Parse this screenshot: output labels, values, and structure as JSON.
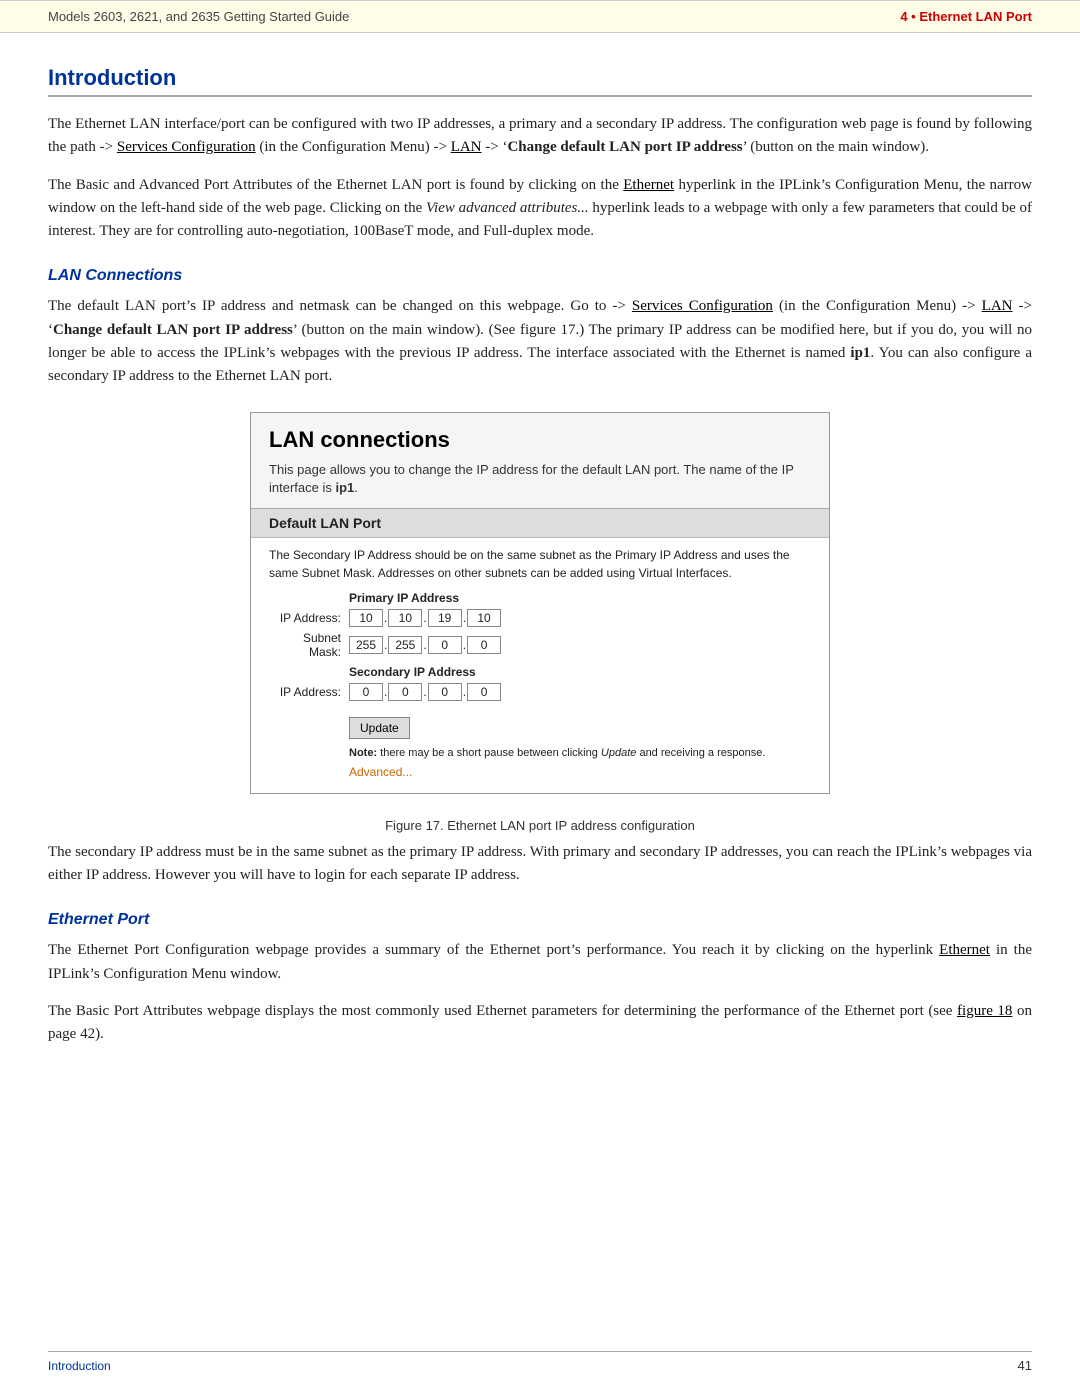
{
  "header": {
    "left": "Models 2603, 2621, and 2635 Getting Started Guide",
    "right_prefix": "4  •  ",
    "right_title": "Ethernet LAN Port"
  },
  "section": {
    "title": "Introduction",
    "paragraphs": [
      "The Ethernet LAN interface/port can be configured with two IP addresses, a primary and a secondary IP address. The configuration web page is found by following the path -> Services Configuration (in the Configuration Menu) -> LAN -> 'Change default LAN port IP address' (button on the main window).",
      "The Basic and Advanced Port Attributes of the Ethernet LAN port is found by clicking on the Ethernet hyperlink in the IPLink's Configuration Menu, the narrow window on the left-hand side of the web page. Clicking on the View advanced attributes... hyperlink leads to a webpage with only a few parameters that could be of interest. They are for controlling auto-negotiation, 100BaseT mode, and Full-duplex mode."
    ]
  },
  "lan_connections": {
    "title": "LAN Connections",
    "paragraphs": [
      "The default LAN port's IP address and netmask can be changed on this webpage. Go to -> Services Configuration (in the Configuration Menu) -> LAN -> 'Change default LAN port IP address' (button on the main window). (See figure 17.) The primary IP address can be modified here, but if you do, you will no longer be able to access the IPLink's webpages with the previous IP address. The interface associated with the Ethernet is named ip1. You can also configure a secondary IP address to the Ethernet LAN port."
    ]
  },
  "webpage_mockup": {
    "title": "LAN connections",
    "desc_line1": "This page allows you to change the IP address for the default LAN port. The name of the IP",
    "desc_line2": "interface is ip1.",
    "section_header": "Default LAN Port",
    "section_body": "The Secondary IP Address should be on the same subnet as the Primary IP Address and uses the same Subnet Mask. Addresses on other subnets can be added using Virtual Interfaces.",
    "primary_label": "Primary IP Address",
    "ip_address_label": "IP Address:",
    "subnet_mask_label": "Subnet Mask:",
    "primary_ip": [
      "10",
      "10",
      "19",
      "10"
    ],
    "subnet_mask": [
      "255",
      "255",
      "0",
      "0"
    ],
    "secondary_label": "Secondary IP Address",
    "secondary_ip_label": "IP Address:",
    "secondary_ip": [
      "0",
      "0",
      "0",
      "0"
    ],
    "update_btn": "Update",
    "note": "Note: there may be a short pause between clicking Update and receiving a response.",
    "advanced_link": "Advanced..."
  },
  "figure_caption": "Figure 17. Ethernet LAN port IP address configuration",
  "secondary_paragraph": "The secondary IP address must be in the same subnet as the primary IP address. With primary and secondary IP addresses, you can reach the IPLink's webpages via either IP address. However you will have to login for each separate IP address.",
  "ethernet_port": {
    "title": "Ethernet Port",
    "paragraphs": [
      "The Ethernet Port Configuration webpage provides a summary of the Ethernet port's performance. You reach it by clicking on the hyperlink Ethernet in the IPLink's Configuration Menu window.",
      "The Basic Port Attributes webpage displays the most commonly used Ethernet parameters for determining the performance of the Ethernet port (see figure 18 on page 42)."
    ]
  },
  "footer": {
    "left": "Introduction",
    "right": "41"
  }
}
